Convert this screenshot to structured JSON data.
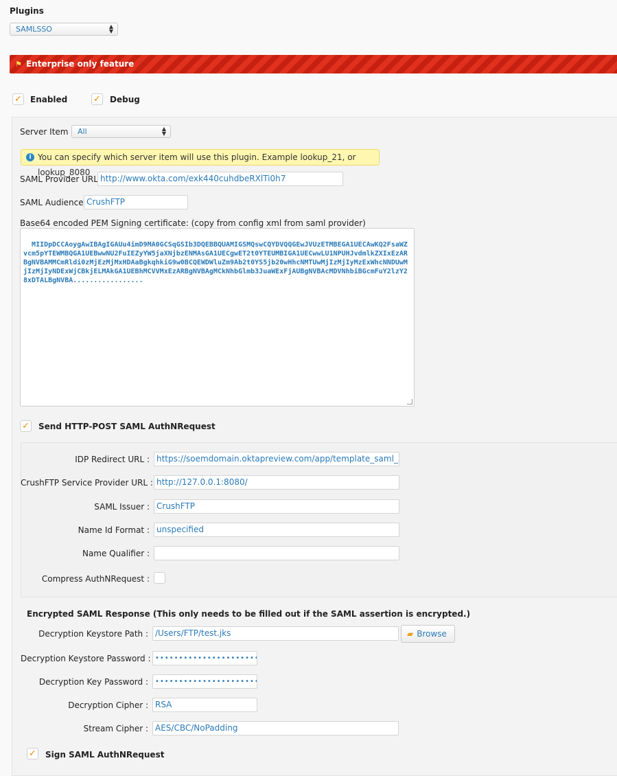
{
  "plugins": {
    "label": "Plugins",
    "selected": "SAMLSSO"
  },
  "banner": {
    "text": "Enterprise only feature"
  },
  "toggles": {
    "enabled": {
      "label": "Enabled",
      "checked": true
    },
    "debug": {
      "label": "Debug",
      "checked": true
    }
  },
  "server_item": {
    "label": "Server Item :",
    "selected": "All"
  },
  "info_message": "You can specify which server item will use this plugin. Example lookup_21, or lookup_8080",
  "saml_provider_url": {
    "label": "SAML Provider URL :",
    "value": "http://www.okta.com/exk440cuhdbeRXlTi0h7"
  },
  "saml_audience": {
    "label": "SAML Audience :",
    "value": "CrushFTP"
  },
  "certificate": {
    "label": "Base64 encoded PEM Signing certificate: (copy from config xml from saml provider)",
    "value": "MIIDpDCCAoygAwIBAgIGAUu4imD9MA0GCSqGSIb3DQEBBQUAMIGSMQswCQYDVQQGEwJVUzETMBEGA1UECAwKQ2FsaWZvcm5pYTEWMBQGA1UEBwwNU2FuIEZyYW5jaXNjbzENMAsGA1UECgwET2t0YTEUMBIGA1UECwwLU1NPUHJvdmlkZXIxEzARBgNVBAMMCmRldi0zMjEzMjMxHDAaBgkqhkiG9w0BCQEWDWluZm9Ab2t0YS5jb20wHhcNMTUwMjIzMjIyMzExWhcNNDUwMjIzMjIyNDExWjCBkjELMAkGA1UEBhMCVVMxEzARBgNVBAgMCkNhbGlmb3JuaWExFjAUBgNVBAcMDVNhbiBGcmFuY2lzY28xDTALBgNVBA................."
  },
  "send_post": {
    "label": "Send HTTP-POST SAML AuthNRequest",
    "checked": true
  },
  "idp_redirect_url": {
    "label": "IDP Redirect URL :",
    "value": "https://soemdomain.oktapreview.com/app/template_saml_2_"
  },
  "sp_url": {
    "label": "CrushFTP Service Provider URL :",
    "value": "http://127.0.0.1:8080/"
  },
  "saml_issuer": {
    "label": "SAML Issuer :",
    "value": "CrushFTP"
  },
  "name_id_format": {
    "label": "Name Id Format :",
    "value": "unspecified"
  },
  "name_qualifier": {
    "label": "Name Qualifier :",
    "value": ""
  },
  "compress": {
    "label": "Compress AuthNRequest :",
    "checked": false
  },
  "encrypted_section": {
    "title": "Encrypted SAML Response (This only needs to be filled out if the SAML assertion is encrypted.)"
  },
  "keystore_path": {
    "label": "Decryption Keystore Path :",
    "value": "/Users/FTP/test.jks",
    "browse_label": "Browse"
  },
  "keystore_password": {
    "label": "Decryption Keystore Password :",
    "value": "••••••••••••••••••••••"
  },
  "key_password": {
    "label": "Decryption Key Password :",
    "value": "••••••••••••••••••••••"
  },
  "decryption_cipher": {
    "label": "Decryption Cipher :",
    "value": "RSA"
  },
  "stream_cipher": {
    "label": "Stream Cipher :",
    "value": "AES/CBC/NoPadding"
  },
  "sign_request": {
    "label": "Sign SAML AuthNRequest",
    "checked": true
  },
  "icons": {
    "flag": "flag-icon",
    "info": "info-icon",
    "folder": "folder-icon",
    "check": "checkmark-icon",
    "select_arrows": "select-arrows-icon"
  },
  "colors": {
    "banner_red": "#d42a16",
    "link_blue": "#2a7ab8",
    "check_orange": "#f08a00",
    "info_yellow": "#fff7b0"
  }
}
